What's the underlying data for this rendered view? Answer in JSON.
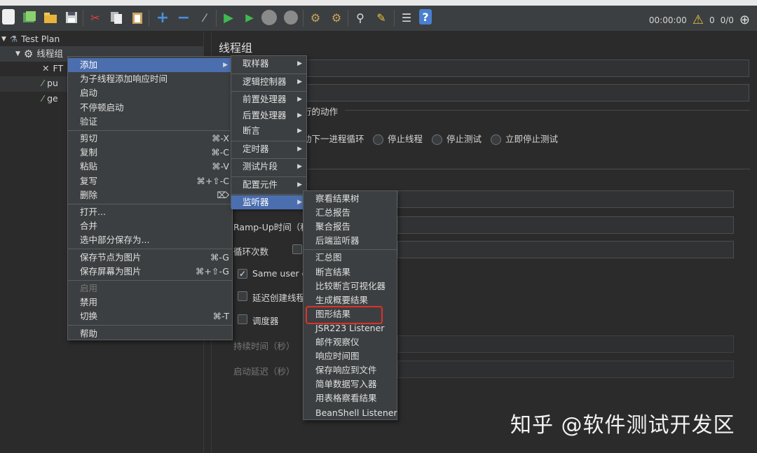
{
  "toolbar": {
    "timer": "00:00:00",
    "warning_count": "0",
    "thread_count": "0/0",
    "icons": [
      "new-icon",
      "templates-icon",
      "open-icon",
      "save-icon",
      "cut-icon",
      "copy-icon",
      "paste-icon",
      "expand-icon",
      "collapse-icon",
      "toggle-icon",
      "start-icon",
      "start-no-pause-icon",
      "stop-icon",
      "shutdown-icon",
      "clear-icon",
      "clear-all-icon",
      "search-icon",
      "reset-search-icon",
      "function-helper-icon",
      "help-icon"
    ]
  },
  "tree": {
    "root": "Test Plan",
    "thread_group": "线程组",
    "children": [
      "FT",
      "pu",
      "ge"
    ]
  },
  "panel": {
    "title": "线程组",
    "action_section_title": "行的动作",
    "radio_options": [
      "动下一进程循环",
      "停止线程",
      "停止测试",
      "立即停止测试"
    ],
    "rampup_label": "Ramp-Up时间（秒）",
    "rampup_visible": "Ramp-Up时间（秒",
    "loop_label": "循环次数",
    "same_user_label": "Same user o",
    "delay_create_label": "延迟创建线程",
    "scheduler_label": "调度器",
    "duration_label": "持续时间（秒）",
    "startup_delay_label": "启动延迟（秒）"
  },
  "context_menu": {
    "groups": [
      [
        {
          "label": "添加",
          "arrow": true,
          "highlight": true
        },
        {
          "label": "为子线程添加响应时间"
        },
        {
          "label": "启动"
        },
        {
          "label": "不停顿启动"
        },
        {
          "label": "验证"
        }
      ],
      [
        {
          "label": "剪切",
          "shortcut": "⌘-X"
        },
        {
          "label": "复制",
          "shortcut": "⌘-C"
        },
        {
          "label": "粘贴",
          "shortcut": "⌘-V"
        },
        {
          "label": "复写",
          "shortcut": "⌘+⇧-C"
        },
        {
          "label": "删除",
          "shortcut": "⌦"
        }
      ],
      [
        {
          "label": "打开..."
        },
        {
          "label": "合并"
        },
        {
          "label": "选中部分保存为..."
        }
      ],
      [
        {
          "label": "保存节点为图片",
          "shortcut": "⌘-G"
        },
        {
          "label": "保存屏幕为图片",
          "shortcut": "⌘+⇧-G"
        }
      ],
      [
        {
          "label": "启用",
          "disabled": true
        },
        {
          "label": "禁用"
        },
        {
          "label": "切换",
          "shortcut": "⌘-T"
        }
      ],
      [
        {
          "label": "帮助"
        }
      ]
    ]
  },
  "add_submenu": {
    "groups": [
      [
        {
          "label": "取样器"
        }
      ],
      [
        {
          "label": "逻辑控制器"
        }
      ],
      [
        {
          "label": "前置处理器"
        },
        {
          "label": "后置处理器"
        },
        {
          "label": "断言"
        }
      ],
      [
        {
          "label": "定时器"
        }
      ],
      [
        {
          "label": "测试片段"
        }
      ],
      [
        {
          "label": "配置元件"
        }
      ],
      [
        {
          "label": "监听器",
          "highlight": true
        }
      ]
    ]
  },
  "listener_submenu": {
    "groups": [
      [
        "察看结果树",
        "汇总报告",
        "聚合报告",
        "后端监听器"
      ],
      [
        "汇总图",
        "断言结果",
        "比较断言可视化器",
        "生成概要结果",
        "图形结果",
        "JSR223 Listener",
        "邮件观察仪",
        "响应时间图",
        "保存响应到文件",
        "简单数据写入器",
        "用表格察看结果",
        "BeanShell Listener"
      ]
    ],
    "boxed_item": "图形结果"
  },
  "watermark": "知乎 @软件测试开发区",
  "colors": {
    "background": "#2b2b2b",
    "menu_bg": "#3c3f41",
    "highlight": "#4b6eaf",
    "annotation_box": "#e0302a"
  }
}
